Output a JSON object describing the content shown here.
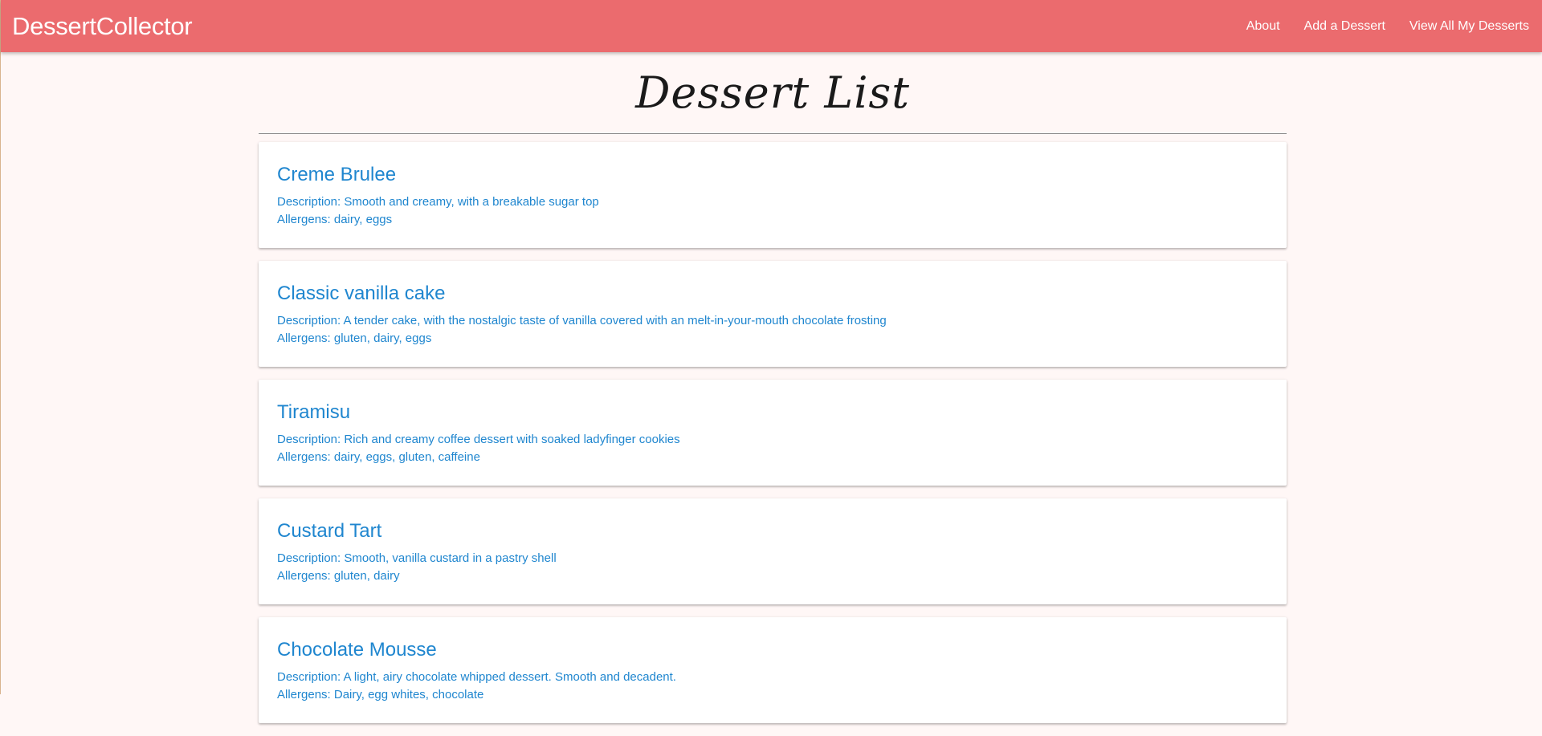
{
  "navbar": {
    "brand": "DessertCollector",
    "links": [
      "About",
      "Add a Dessert",
      "View All My Desserts"
    ]
  },
  "page": {
    "title": "Dessert List"
  },
  "desserts": [
    {
      "name": "Creme Brulee",
      "description": "Description: Smooth and creamy, with a breakable sugar top",
      "allergens": "Allergens: dairy, eggs"
    },
    {
      "name": "Classic vanilla cake",
      "description": "Description: A tender cake, with the nostalgic taste of vanilla covered with an melt-in-your-mouth chocolate frosting",
      "allergens": "Allergens: gluten, dairy, eggs"
    },
    {
      "name": "Tiramisu",
      "description": "Description: Rich and creamy coffee dessert with soaked ladyfinger cookies",
      "allergens": "Allergens: dairy, eggs, gluten, caffeine"
    },
    {
      "name": "Custard Tart",
      "description": "Description: Smooth, vanilla custard in a pastry shell",
      "allergens": "Allergens: gluten, dairy"
    },
    {
      "name": "Chocolate Mousse",
      "description": "Description: A light, airy chocolate whipped dessert. Smooth and decadent.",
      "allergens": "Allergens: Dairy, egg whites, chocolate"
    }
  ],
  "colors": {
    "navbar": "#eb6b6e",
    "background": "#fff7f6",
    "link_text": "#1f86cf"
  }
}
